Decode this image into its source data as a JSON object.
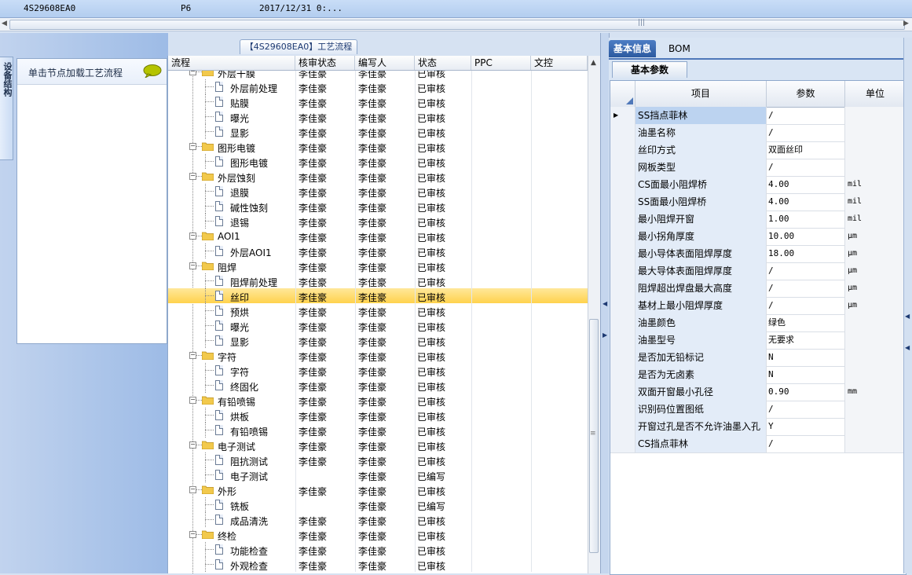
{
  "top_row": {
    "code": "4S29608EA0",
    "layer": "P6",
    "date": "2017/12/31 0:..."
  },
  "left_panel": {
    "side_tab": "设备结构",
    "hint": "单击节点加载工艺流程",
    "bubble_icon": "speech-bubble-icon"
  },
  "process": {
    "title": "【4S29608EA0】工艺流程",
    "columns": {
      "flow": "流程",
      "check": "核审状态",
      "author": "编写人",
      "status": "状态",
      "ppc": "PPC",
      "doc": "文控"
    },
    "rows": [
      {
        "label": "外层干膜",
        "level": 0,
        "check": "李佳豪",
        "author": "李佳豪",
        "status": "已审核",
        "partial": true
      },
      {
        "label": "外层前处理",
        "level": 1,
        "check": "李佳豪",
        "author": "李佳豪",
        "status": "已审核"
      },
      {
        "label": "贴膜",
        "level": 1,
        "check": "李佳豪",
        "author": "李佳豪",
        "status": "已审核"
      },
      {
        "label": "曝光",
        "level": 1,
        "check": "李佳豪",
        "author": "李佳豪",
        "status": "已审核"
      },
      {
        "label": "显影",
        "level": 1,
        "check": "李佳豪",
        "author": "李佳豪",
        "status": "已审核"
      },
      {
        "label": "图形电镀",
        "level": 0,
        "check": "李佳豪",
        "author": "李佳豪",
        "status": "已审核"
      },
      {
        "label": "图形电镀",
        "level": 1,
        "check": "李佳豪",
        "author": "李佳豪",
        "status": "已审核"
      },
      {
        "label": "外层蚀刻",
        "level": 0,
        "check": "李佳豪",
        "author": "李佳豪",
        "status": "已审核"
      },
      {
        "label": "退膜",
        "level": 1,
        "check": "李佳豪",
        "author": "李佳豪",
        "status": "已审核"
      },
      {
        "label": "碱性蚀刻",
        "level": 1,
        "check": "李佳豪",
        "author": "李佳豪",
        "status": "已审核"
      },
      {
        "label": "退锡",
        "level": 1,
        "check": "李佳豪",
        "author": "李佳豪",
        "status": "已审核"
      },
      {
        "label": "AOI1",
        "level": 0,
        "check": "李佳豪",
        "author": "李佳豪",
        "status": "已审核"
      },
      {
        "label": "外层AOI1",
        "level": 1,
        "check": "李佳豪",
        "author": "李佳豪",
        "status": "已审核"
      },
      {
        "label": "阻焊",
        "level": 0,
        "check": "李佳豪",
        "author": "李佳豪",
        "status": "已审核"
      },
      {
        "label": "阻焊前处理",
        "level": 1,
        "check": "李佳豪",
        "author": "李佳豪",
        "status": "已审核"
      },
      {
        "label": "丝印",
        "level": 1,
        "check": "李佳豪",
        "author": "李佳豪",
        "status": "已审核",
        "selected": true
      },
      {
        "label": "预烘",
        "level": 1,
        "check": "李佳豪",
        "author": "李佳豪",
        "status": "已审核"
      },
      {
        "label": "曝光",
        "level": 1,
        "check": "李佳豪",
        "author": "李佳豪",
        "status": "已审核"
      },
      {
        "label": "显影",
        "level": 1,
        "check": "李佳豪",
        "author": "李佳豪",
        "status": "已审核"
      },
      {
        "label": "字符",
        "level": 0,
        "check": "李佳豪",
        "author": "李佳豪",
        "status": "已审核"
      },
      {
        "label": "字符",
        "level": 1,
        "check": "李佳豪",
        "author": "李佳豪",
        "status": "已审核"
      },
      {
        "label": "终固化",
        "level": 1,
        "check": "李佳豪",
        "author": "李佳豪",
        "status": "已审核"
      },
      {
        "label": "有铅喷锡",
        "level": 0,
        "check": "李佳豪",
        "author": "李佳豪",
        "status": "已审核"
      },
      {
        "label": "烘板",
        "level": 1,
        "check": "李佳豪",
        "author": "李佳豪",
        "status": "已审核"
      },
      {
        "label": "有铅喷锡",
        "level": 1,
        "check": "李佳豪",
        "author": "李佳豪",
        "status": "已审核"
      },
      {
        "label": "电子测试",
        "level": 0,
        "check": "李佳豪",
        "author": "李佳豪",
        "status": "已审核"
      },
      {
        "label": "阻抗测试",
        "level": 1,
        "check": "李佳豪",
        "author": "李佳豪",
        "status": "已审核"
      },
      {
        "label": "电子测试",
        "level": 1,
        "check": "",
        "author": "李佳豪",
        "status": "已编写"
      },
      {
        "label": "外形",
        "level": 0,
        "check": "李佳豪",
        "author": "李佳豪",
        "status": "已审核"
      },
      {
        "label": "铣板",
        "level": 1,
        "check": "",
        "author": "李佳豪",
        "status": "已编写"
      },
      {
        "label": "成品清洗",
        "level": 1,
        "check": "李佳豪",
        "author": "李佳豪",
        "status": "已审核"
      },
      {
        "label": "终检",
        "level": 0,
        "check": "李佳豪",
        "author": "李佳豪",
        "status": "已审核"
      },
      {
        "label": "功能检查",
        "level": 1,
        "check": "李佳豪",
        "author": "李佳豪",
        "status": "已审核"
      },
      {
        "label": "外观检查",
        "level": 1,
        "check": "李佳豪",
        "author": "李佳豪",
        "status": "已审核"
      }
    ]
  },
  "right_panel": {
    "tabs": [
      "基本信息",
      "BOM"
    ],
    "subtab": "基本参数",
    "columns": {
      "item": "项目",
      "value": "参数",
      "unit": "单位"
    },
    "params": [
      {
        "item": "SS挡点菲林",
        "value": "/",
        "unit": ""
      },
      {
        "item": "油墨名称",
        "value": "/",
        "unit": ""
      },
      {
        "item": "丝印方式",
        "value": "双面丝印",
        "unit": ""
      },
      {
        "item": "网板类型",
        "value": "/",
        "unit": ""
      },
      {
        "item": "CS面最小阻焊桥",
        "value": "4.00",
        "unit": "mil"
      },
      {
        "item": "SS面最小阻焊桥",
        "value": "4.00",
        "unit": "mil"
      },
      {
        "item": "最小阻焊开窗",
        "value": "1.00",
        "unit": "mil"
      },
      {
        "item": "最小拐角厚度",
        "value": "10.00",
        "unit": "μm"
      },
      {
        "item": "最小导体表面阻焊厚度",
        "value": "18.00",
        "unit": "μm"
      },
      {
        "item": "最大导体表面阻焊厚度",
        "value": "/",
        "unit": "μm"
      },
      {
        "item": "阻焊超出焊盘最大高度",
        "value": "/",
        "unit": "μm"
      },
      {
        "item": "基材上最小阻焊厚度",
        "value": "/",
        "unit": "μm"
      },
      {
        "item": "油墨颜色",
        "value": "绿色",
        "unit": ""
      },
      {
        "item": "油墨型号",
        "value": "无要求",
        "unit": ""
      },
      {
        "item": "是否加无铅标记",
        "value": "N",
        "unit": ""
      },
      {
        "item": "是否为无卤素",
        "value": "N",
        "unit": ""
      },
      {
        "item": "双面开窗最小孔径",
        "value": "0.90",
        "unit": "mm"
      },
      {
        "item": "识别码位置图纸",
        "value": "/",
        "unit": ""
      },
      {
        "item": "开窗过孔是否不允许油墨入孔",
        "value": "Y",
        "unit": ""
      },
      {
        "item": "CS挡点菲林",
        "value": "/",
        "unit": ""
      }
    ]
  }
}
